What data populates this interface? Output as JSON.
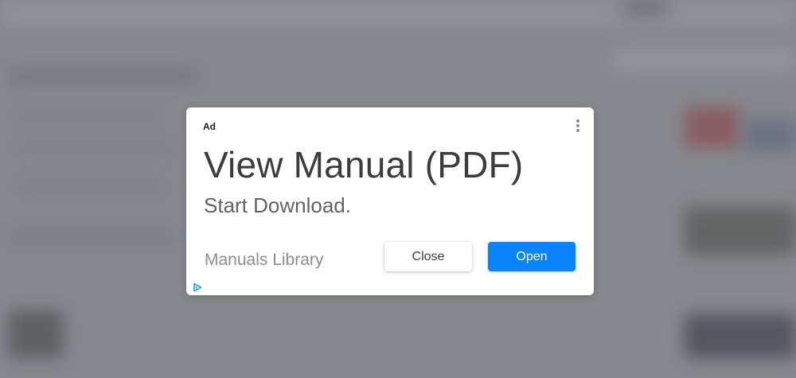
{
  "ad": {
    "badge": "Ad",
    "title": "View Manual (PDF)",
    "subtitle": "Start Download.",
    "advertiser": "Manuals Library",
    "close_label": "Close",
    "open_label": "Open",
    "menu_icon": "more-vertical-icon",
    "adchoices_icon": "adchoices-icon"
  },
  "colors": {
    "accent": "#0a84ff",
    "title_text": "#3c3c3c",
    "muted_text": "#8a8d91",
    "backdrop": "#8b8e93"
  }
}
